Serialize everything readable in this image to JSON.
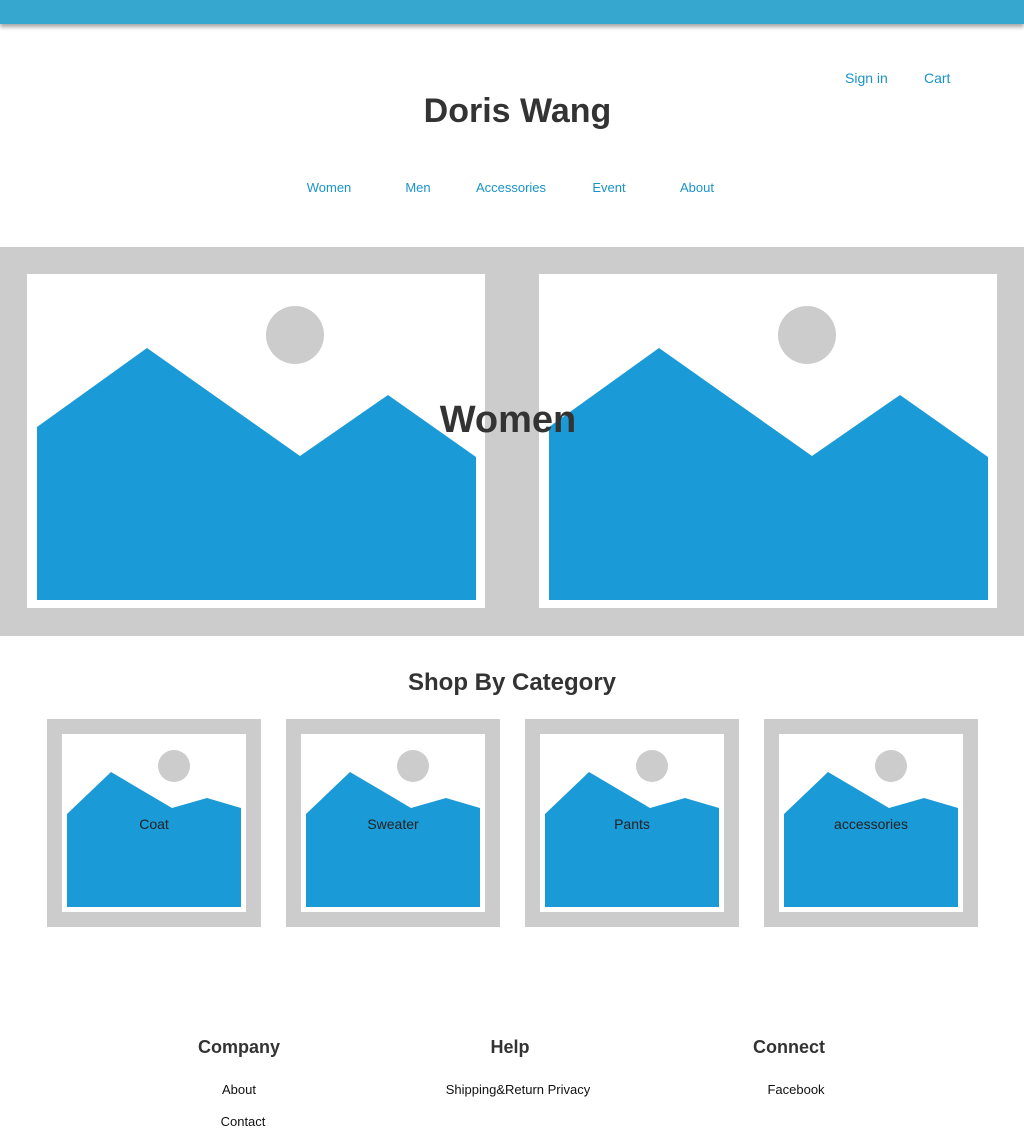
{
  "header": {
    "brand": "Doris Wang",
    "sign_in": "Sign in",
    "cart": "Cart"
  },
  "nav": {
    "items": [
      {
        "label": "Women"
      },
      {
        "label": "Men"
      },
      {
        "label": "Accessories"
      },
      {
        "label": "Event"
      },
      {
        "label": "About"
      }
    ]
  },
  "hero": {
    "title": "Women"
  },
  "categories": {
    "title": "Shop By Category",
    "items": [
      {
        "label": "Coat"
      },
      {
        "label": "Sweater"
      },
      {
        "label": "Pants"
      },
      {
        "label": "accessories"
      }
    ]
  },
  "footer": {
    "company": {
      "heading": "Company",
      "links": [
        "About",
        "Contact"
      ]
    },
    "help": {
      "heading": "Help",
      "links": [
        "Shipping&Return Privacy"
      ]
    },
    "connect": {
      "heading": "Connect",
      "links": [
        "Facebook"
      ]
    }
  },
  "colors": {
    "accent": "#36a8d0",
    "link": "#1a93c8",
    "placeholder_fill": "#1a9ad6",
    "placeholder_bg": "#cccccc",
    "text_dark": "#333333"
  }
}
